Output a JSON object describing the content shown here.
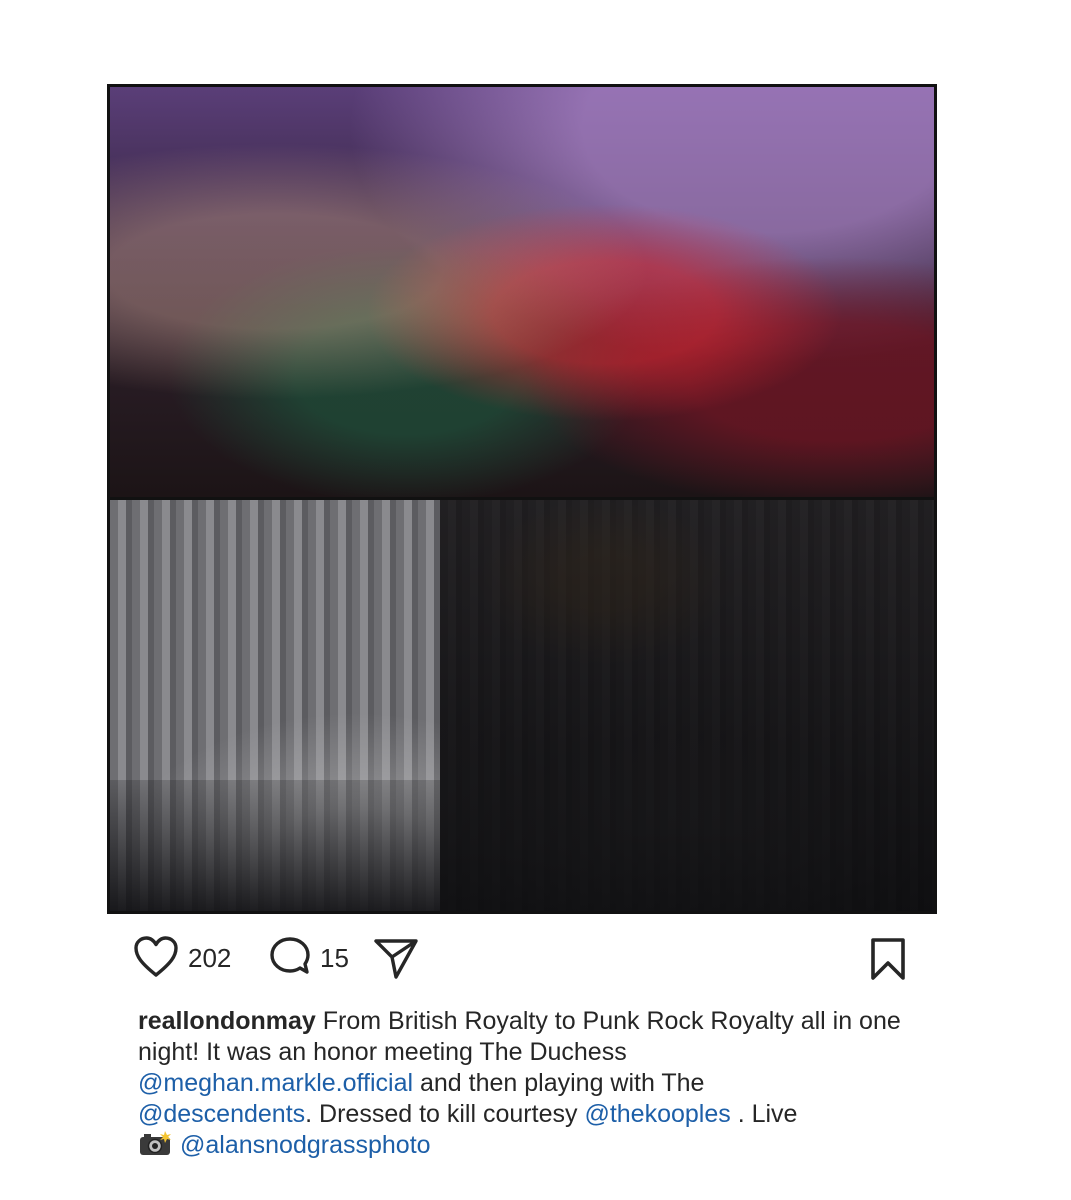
{
  "post": {
    "likes": "202",
    "comments": "15",
    "caption": {
      "username": "reallondonmay",
      "text_1": "From British Royalty to Punk Rock Royalty all in one night! It was an honor meeting The Duchess",
      "mention_1": "@meghan.markle.official",
      "text_2": "and then playing with The",
      "mention_2": "@descendents",
      "text_3": ". Dressed to kill courtesy",
      "mention_3": "@thekooples",
      "text_4": ". Live",
      "mention_4": "@alansnodgrassphoto"
    }
  },
  "icons": {
    "like": "heart-icon",
    "comment": "comment-bubble-icon",
    "share": "paper-plane-icon",
    "save": "bookmark-icon",
    "camera": "camera-flash-emoji"
  },
  "colors": {
    "text": "#262626",
    "mention": "#1d5fa8",
    "frame": "#111111"
  }
}
